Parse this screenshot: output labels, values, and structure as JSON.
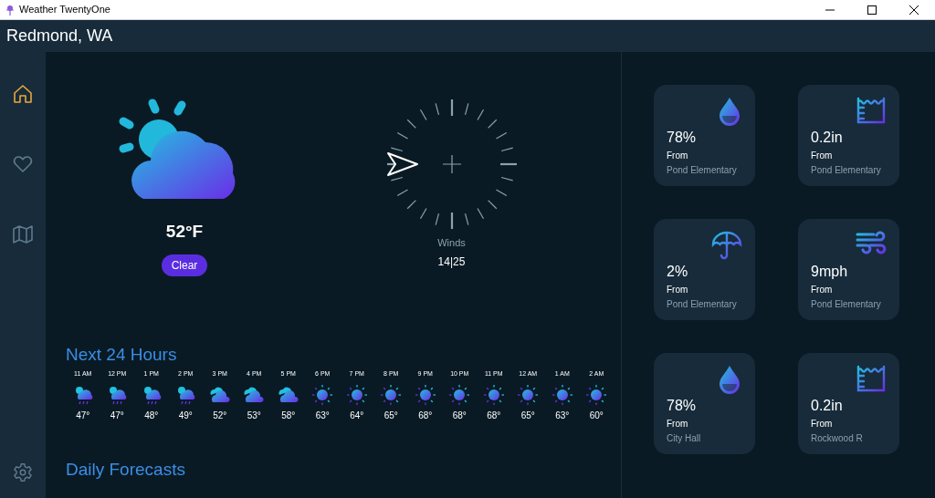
{
  "window": {
    "title": "Weather TwentyOne"
  },
  "header": {
    "location": "Redmond, WA"
  },
  "sidebar": {
    "items": [
      {
        "kind": "home",
        "selected": true
      },
      {
        "kind": "heart",
        "selected": false
      },
      {
        "kind": "map",
        "selected": false
      }
    ],
    "settings": {
      "kind": "settings"
    }
  },
  "current": {
    "temperature": "52°F",
    "condition": "Clear"
  },
  "wind": {
    "label": "Winds",
    "reading": "14|25"
  },
  "next_24_hours": {
    "title": "Next 24 Hours",
    "hours": [
      {
        "time": "11 AM",
        "kind": "rain",
        "temp": "47°"
      },
      {
        "time": "12 PM",
        "kind": "rain",
        "temp": "47°"
      },
      {
        "time": "1 PM",
        "kind": "rain",
        "temp": "48°"
      },
      {
        "time": "2 PM",
        "kind": "rain",
        "temp": "49°"
      },
      {
        "time": "3 PM",
        "kind": "cloudy",
        "temp": "52°"
      },
      {
        "time": "4 PM",
        "kind": "cloudy",
        "temp": "53°"
      },
      {
        "time": "5 PM",
        "kind": "cloudy",
        "temp": "58°"
      },
      {
        "time": "6 PM",
        "kind": "sunny",
        "temp": "63°"
      },
      {
        "time": "7 PM",
        "kind": "sunny",
        "temp": "64°"
      },
      {
        "time": "8 PM",
        "kind": "sunny",
        "temp": "65°"
      },
      {
        "time": "9 PM",
        "kind": "sunny",
        "temp": "68°"
      },
      {
        "time": "10 PM",
        "kind": "sunny",
        "temp": "68°"
      },
      {
        "time": "11 PM",
        "kind": "sunny",
        "temp": "68°"
      },
      {
        "time": "12 AM",
        "kind": "sunny",
        "temp": "65°"
      },
      {
        "time": "1 AM",
        "kind": "sunny",
        "temp": "63°"
      },
      {
        "time": "2 AM",
        "kind": "sunny",
        "temp": "60°"
      }
    ]
  },
  "daily_forecasts": {
    "title": "Daily Forecasts"
  },
  "widgets": [
    {
      "kind": "humidity",
      "value": "78%",
      "from_label": "From",
      "source": "Pond Elementary"
    },
    {
      "kind": "rainfall",
      "value": "0.2in",
      "from_label": "From",
      "source": "Pond Elementary"
    },
    {
      "kind": "umbrella",
      "value": "2%",
      "from_label": "From",
      "source": "Pond Elementary"
    },
    {
      "kind": "wind",
      "value": "9mph",
      "from_label": "From",
      "source": "Pond Elementary"
    },
    {
      "kind": "humidity",
      "value": "78%",
      "from_label": "From",
      "source": "City Hall"
    },
    {
      "kind": "rainfall",
      "value": "0.2in",
      "from_label": "From",
      "source": "Rockwood R"
    }
  ]
}
